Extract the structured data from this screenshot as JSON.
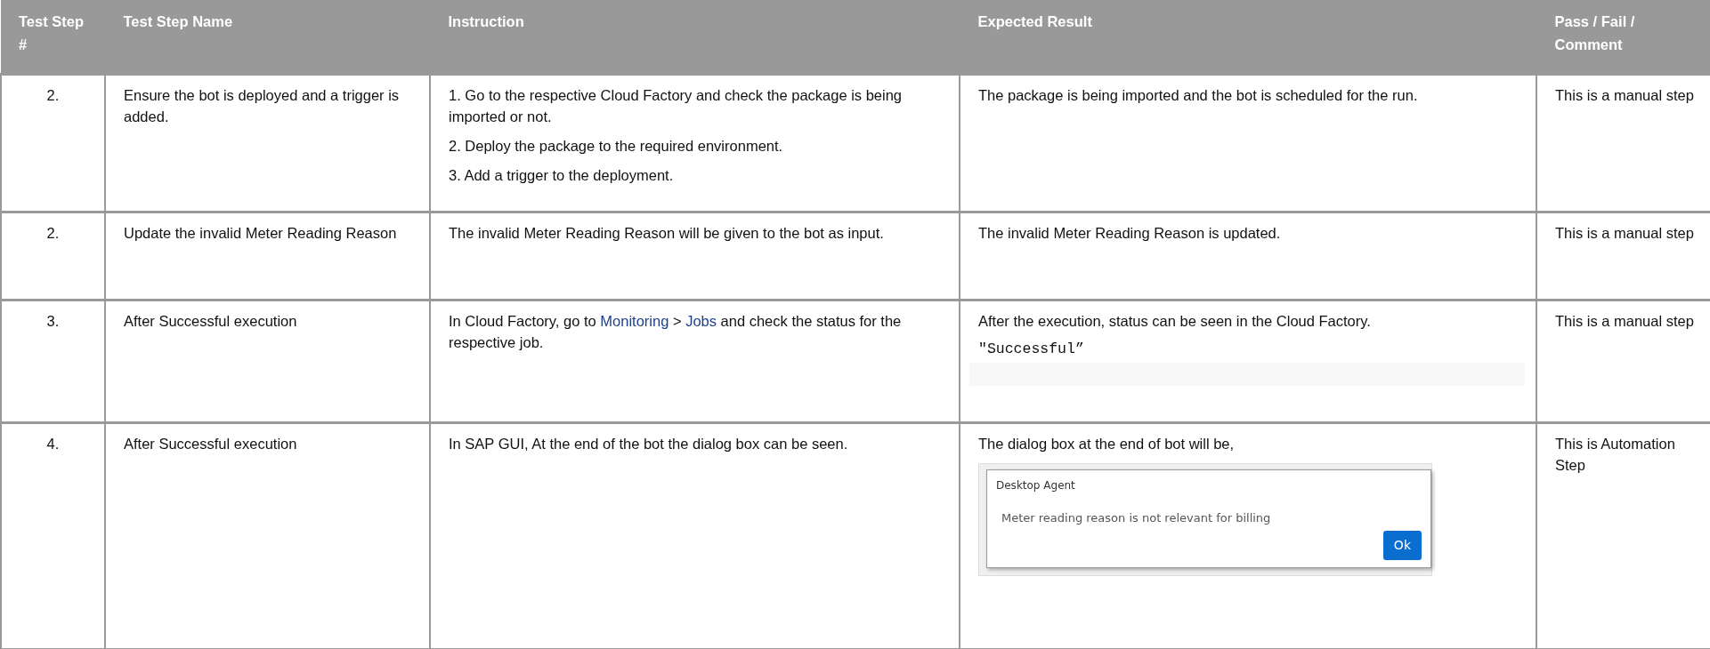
{
  "table": {
    "columns": [
      "Test Step #",
      "Test Step Name",
      "Instruction",
      "Expected Result",
      "Pass / Fail / Comment"
    ],
    "rows": [
      {
        "step": "2.",
        "name": "Ensure the bot is deployed and a trigger is added.",
        "instruction": [
          [
            {
              "kind": "text",
              "text": "1. Go to the respective Cloud Factory and check the package is being imported or not."
            }
          ],
          [
            {
              "kind": "text",
              "text": "2. Deploy the package to the required environment."
            }
          ],
          [
            {
              "kind": "text",
              "text": "3. Add a trigger to the deployment."
            }
          ]
        ],
        "expected": [
          {
            "kind": "text",
            "text": "The package is being imported and the bot is scheduled for the run."
          }
        ],
        "comment": "This is a manual step"
      },
      {
        "step": "2.",
        "name": "Update the invalid Meter Reading Reason",
        "instruction": [
          [
            {
              "kind": "text",
              "text": "The invalid Meter Reading Reason will be given to the bot as input."
            }
          ]
        ],
        "expected": [
          {
            "kind": "text",
            "text": "The invalid Meter Reading Reason is updated."
          }
        ],
        "comment": "This is a manual step"
      },
      {
        "step": "3.",
        "name": "After Successful execution",
        "instruction": [
          [
            {
              "kind": "text",
              "text": "In Cloud Factory, go to "
            },
            {
              "kind": "link",
              "text": "Monitoring"
            },
            {
              "kind": "text",
              "text": " > "
            },
            {
              "kind": "link",
              "text": "Jobs"
            },
            {
              "kind": "text",
              "text": " and check the status for the respective job."
            }
          ]
        ],
        "expected": [
          {
            "kind": "text",
            "text": "After the execution, status can be seen in the Cloud Factory."
          },
          {
            "kind": "code",
            "text": "\"Successful”"
          }
        ],
        "comment": " This is a manual step"
      },
      {
        "step": "4.",
        "name": "After Successful execution",
        "instruction": [
          [
            {
              "kind": "text",
              "text": "In SAP GUI, At the end of the bot the dialog box can be seen."
            }
          ]
        ],
        "expected": [
          {
            "kind": "text",
            "text": "The dialog box at the end of bot will be,"
          },
          {
            "kind": "dialog",
            "title": "Desktop Agent",
            "message": "Meter reading reason is not relevant for billing",
            "button": "Ok"
          }
        ],
        "comment": "This is Automation Step"
      }
    ]
  }
}
